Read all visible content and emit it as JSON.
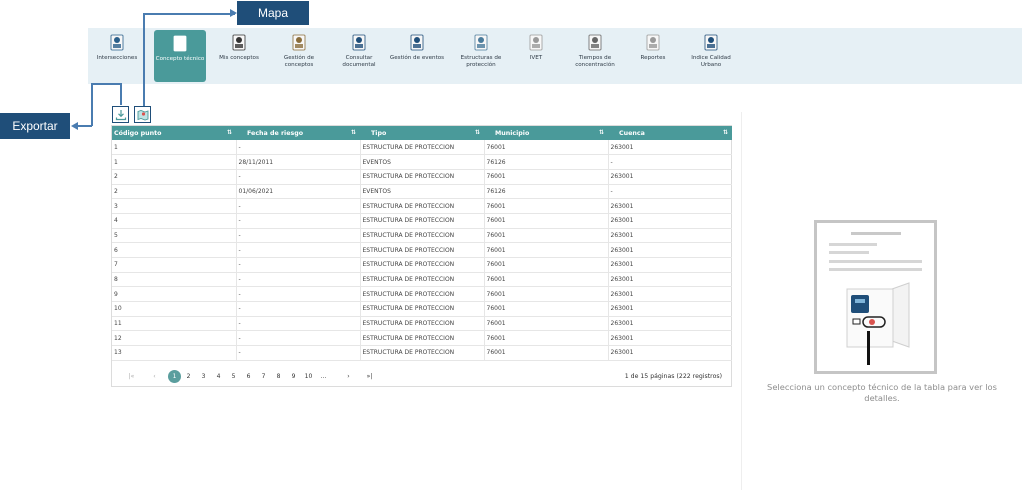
{
  "nav": {
    "items": [
      {
        "label": "Intersecciones",
        "icon": "intersection-icon"
      },
      {
        "label": "Concepto técnico",
        "icon": "technician-icon",
        "active": true
      },
      {
        "label": "Mis conceptos",
        "icon": "people-icon"
      },
      {
        "label": "Gestión de conceptos",
        "icon": "document-management-icon"
      },
      {
        "label": "Consultar documental",
        "icon": "document-search-icon"
      },
      {
        "label": "Gestión de eventos",
        "icon": "landslide-icon"
      },
      {
        "label": "Estructuras de protección",
        "icon": "protection-structure-icon"
      },
      {
        "label": "IVET",
        "icon": "ivet-document-icon"
      },
      {
        "label": "Tiempos de concentración",
        "icon": "stopwatch-icon"
      },
      {
        "label": "Reportes",
        "icon": "reports-icon"
      },
      {
        "label": "Indice Calidad Urbano",
        "icon": "urban-quality-icon"
      }
    ],
    "accent": "#4a9a9a",
    "background": "#e6f0f5"
  },
  "callouts": {
    "mapa": "Mapa",
    "exportar": "Exportar",
    "color": "#1f4e79"
  },
  "table": {
    "columns": [
      "Código punto",
      "Fecha de riesgo",
      "Tipo",
      "Municipio",
      "Cuenca"
    ],
    "rows": [
      [
        "1",
        "-",
        "ESTRUCTURA DE PROTECCION",
        "76001",
        "263001"
      ],
      [
        "1",
        "28/11/2011",
        "EVENTOS",
        "76126",
        "-"
      ],
      [
        "2",
        "-",
        "ESTRUCTURA DE PROTECCION",
        "76001",
        "263001"
      ],
      [
        "2",
        "01/06/2021",
        "EVENTOS",
        "76126",
        "-"
      ],
      [
        "3",
        "-",
        "ESTRUCTURA DE PROTECCION",
        "76001",
        "263001"
      ],
      [
        "4",
        "-",
        "ESTRUCTURA DE PROTECCION",
        "76001",
        "263001"
      ],
      [
        "5",
        "-",
        "ESTRUCTURA DE PROTECCION",
        "76001",
        "263001"
      ],
      [
        "6",
        "-",
        "ESTRUCTURA DE PROTECCION",
        "76001",
        "263001"
      ],
      [
        "7",
        "-",
        "ESTRUCTURA DE PROTECCION",
        "76001",
        "263001"
      ],
      [
        "8",
        "-",
        "ESTRUCTURA DE PROTECCION",
        "76001",
        "263001"
      ],
      [
        "9",
        "-",
        "ESTRUCTURA DE PROTECCION",
        "76001",
        "263001"
      ],
      [
        "10",
        "-",
        "ESTRUCTURA DE PROTECCION",
        "76001",
        "263001"
      ],
      [
        "11",
        "-",
        "ESTRUCTURA DE PROTECCION",
        "76001",
        "263001"
      ],
      [
        "12",
        "-",
        "ESTRUCTURA DE PROTECCION",
        "76001",
        "263001"
      ],
      [
        "13",
        "-",
        "ESTRUCTURA DE PROTECCION",
        "76001",
        "263001"
      ]
    ],
    "header_color": "#4a9a9a"
  },
  "pager": {
    "first": "|«",
    "prev": "‹",
    "pages": [
      "1",
      "2",
      "3",
      "4",
      "5",
      "6",
      "7",
      "8",
      "9",
      "10"
    ],
    "current": "1",
    "ellipsis": "...",
    "next": "›",
    "last": "»|",
    "info": "1 de 15 páginas (222 registros)"
  },
  "detail": {
    "message": "Selecciona un concepto técnico de la tabla para ver los detalles."
  }
}
